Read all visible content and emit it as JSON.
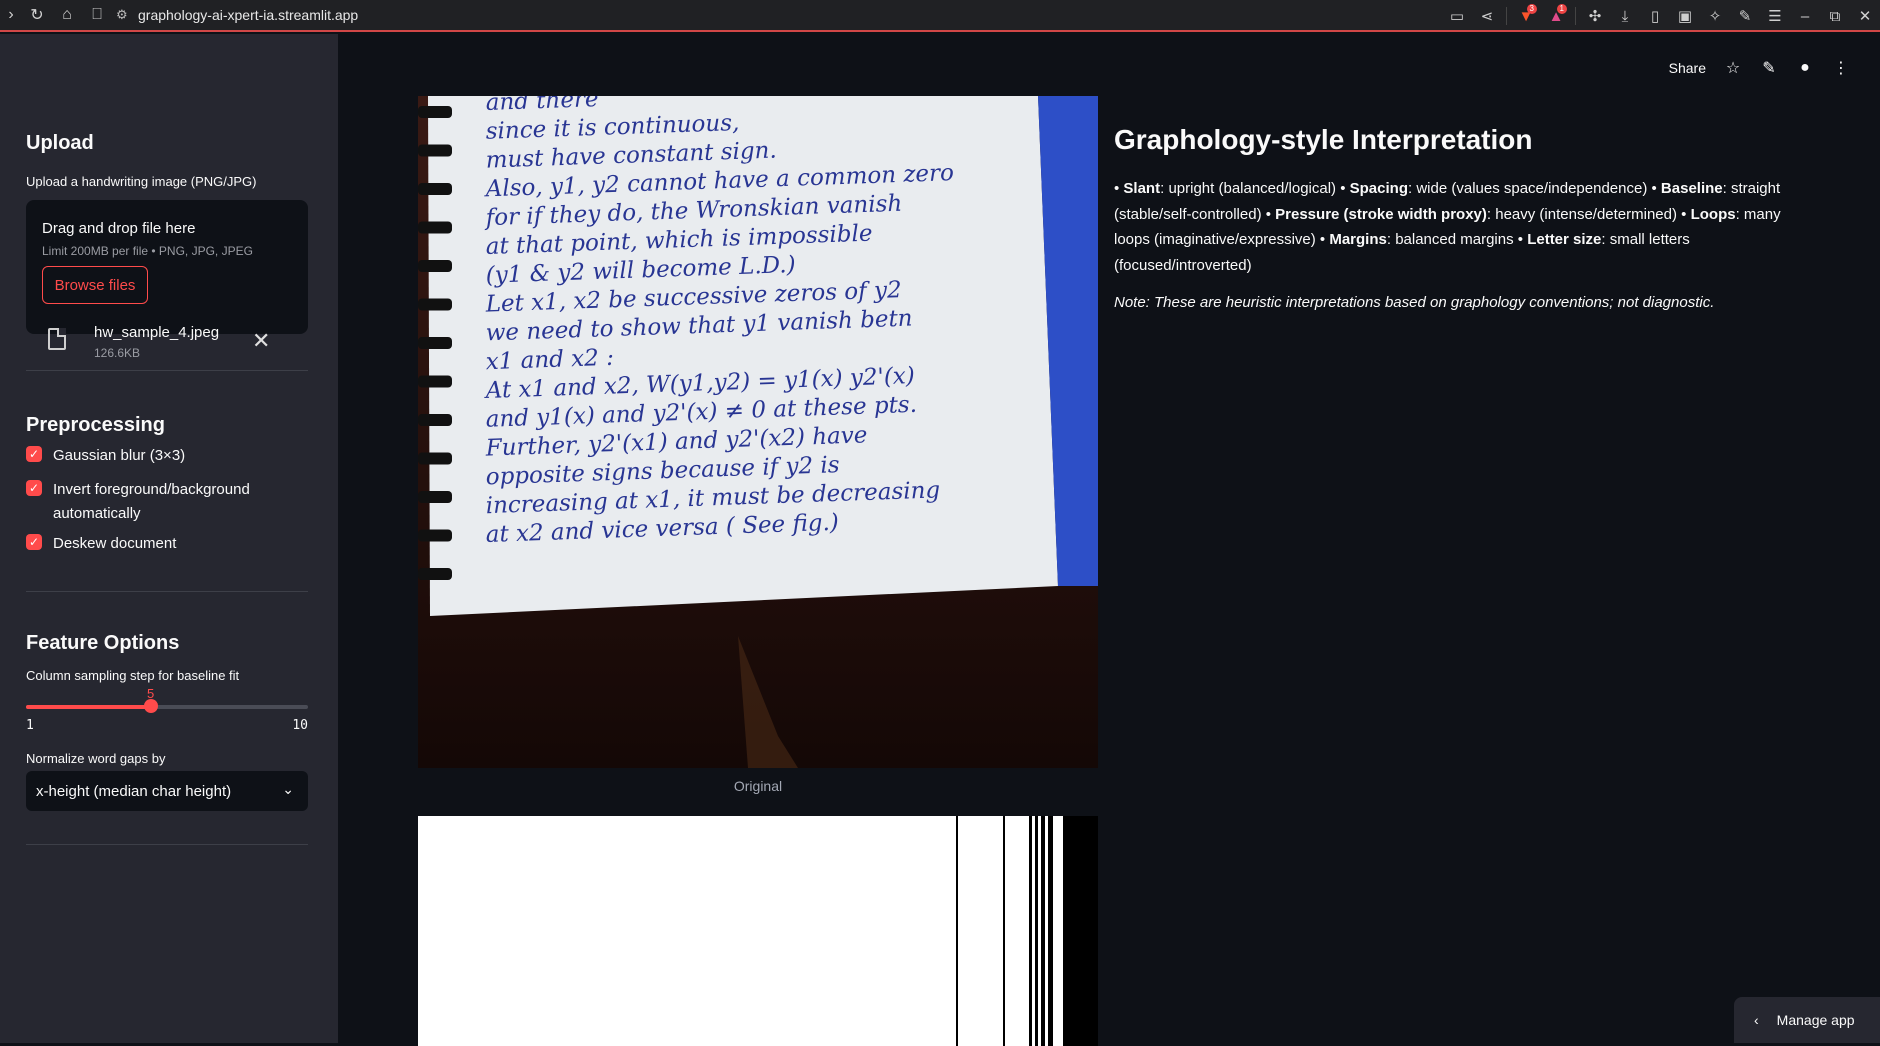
{
  "browser": {
    "url": "graphology-ai-xpert-ia.streamlit.app"
  },
  "sidebar": {
    "upload_heading": "Upload",
    "upload_label": "Upload a handwriting image (PNG/JPG)",
    "dropzone_title": "Drag and drop file here",
    "dropzone_limit": "Limit 200MB per file • PNG, JPG, JPEG",
    "browse_label": "Browse files",
    "file_name": "hw_sample_4.jpeg",
    "file_size": "126.6KB",
    "preprocessing_heading": "Preprocessing",
    "checks": [
      {
        "label": "Gaussian blur (3×3)",
        "checked": true
      },
      {
        "label": "Invert foreground/background automatically",
        "checked": true
      },
      {
        "label": "Deskew document",
        "checked": true
      }
    ],
    "feature_heading": "Feature Options",
    "slider_label": "Column sampling step for baseline fit",
    "slider": {
      "value": "5",
      "min": "1",
      "max": "10",
      "fraction": 0.444
    },
    "gap_label": "Normalize word gaps by",
    "gap_value": "x-height (median char height)"
  },
  "toolbar": {
    "share_label": "Share"
  },
  "main": {
    "caption_original": "Original",
    "interp_title": "Graphology-style Interpretation",
    "traits": [
      {
        "sep": "• ",
        "key": "Slant",
        "value": ": upright (balanced/logical) "
      },
      {
        "sep": "• ",
        "key": "Spacing",
        "value": ": wide (values space/independence) "
      },
      {
        "sep": "• ",
        "key": "Baseline",
        "value": ": straight (stable/self-controlled) "
      },
      {
        "sep": "• ",
        "key": "Pressure (stroke width proxy)",
        "value": ": heavy (intense/determined) "
      },
      {
        "sep": "• ",
        "key": "Loops",
        "value": ": many loops (imaginative/expressive) "
      },
      {
        "sep": "• ",
        "key": "Margins",
        "value": ": balanced margins "
      },
      {
        "sep": "• ",
        "key": "Letter size",
        "value": ": small letters (focused/introverted)"
      }
    ],
    "note": "Note: These are heuristic interpretations based on graphology conventions; not diagnostic.",
    "handwriting_lines": [
      "and there",
      "since it is continuous,",
      "must have constant sign.",
      "Also, y1, y2 cannot have a common zero",
      "for if they do, the Wronskian vanish",
      "at that point, which is impossible",
      "(y1 & y2 will become L.D.)",
      "Let x1, x2 be successive zeros of y2",
      "we need to show that y1 vanish betn",
      "x1 and x2 :",
      "At x1 and x2,  W(y1,y2) = y1(x) y2'(x)",
      "and y1(x) and y2'(x) ≠ 0 at these pts.",
      "Further, y2'(x1) and y2'(x2) have",
      "opposite signs because if y2 is",
      "increasing at x1, it must be decreasing",
      "at x2 and vice versa ( See fig.)"
    ]
  },
  "manage_label": "Manage app"
}
